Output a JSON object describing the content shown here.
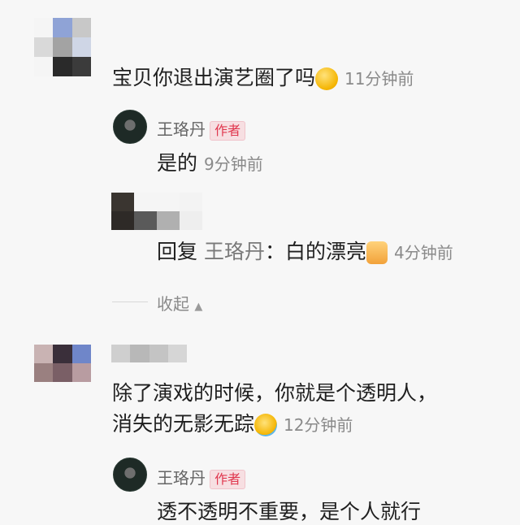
{
  "comments": [
    {
      "text": "宝贝你退出演艺圈了吗",
      "emoji_icon": "shush-face-emoji-icon",
      "time": "11分钟前",
      "replies": [
        {
          "author": "王珞丹",
          "badge": "作者",
          "text": "是的",
          "time": "9分钟前"
        },
        {
          "reply_prefix": "回复",
          "reply_target": "王珞丹",
          "reply_sep": "：",
          "text": "白的漂亮",
          "emoji_icon": "thumbs-up-emoji-icon",
          "time": "4分钟前"
        }
      ],
      "collapse_label": "收起",
      "collapse_icon": "caret-up-icon"
    },
    {
      "text_line1": "除了演戏的时候，你就是个透明人，",
      "text_line2": "消失的无影无踪",
      "emoji_icon": "laughing-tears-emoji-icon",
      "time": "12分钟前",
      "replies": [
        {
          "author": "王珞丹",
          "badge": "作者",
          "text": "透不透明不重要，是个人就行"
        }
      ]
    }
  ]
}
